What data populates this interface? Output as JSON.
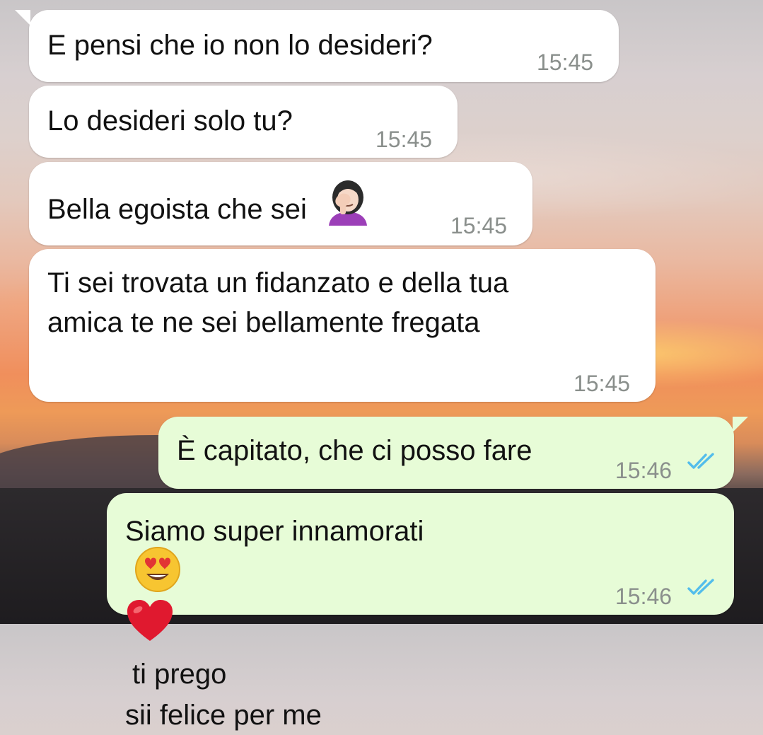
{
  "messages": [
    {
      "direction": "received",
      "text": "E pensi che io non lo desideri?",
      "time": "15:45"
    },
    {
      "direction": "received",
      "text": "Lo desideri solo tu?",
      "time": "15:45"
    },
    {
      "direction": "received",
      "text": "Bella egoista che sei",
      "emoji": "woman-facepalming",
      "time": "15:45"
    },
    {
      "direction": "received",
      "lines": [
        "Ti sei trovata un fidanzato e della tua",
        "amica te ne sei bellamente fregata"
      ],
      "time": "15:45"
    },
    {
      "direction": "sent",
      "text": "È capitato, che ci posso fare",
      "time": "15:46",
      "status": "read"
    },
    {
      "direction": "sent",
      "lines": [
        "Siamo super innamorati",
        "sii felice per me"
      ],
      "line1_tail": "ti prego",
      "emojis": [
        "heart-eyes-face",
        "red-heart"
      ],
      "time": "15:46",
      "status": "read"
    }
  ],
  "colors": {
    "received_bubble": "#ffffff",
    "sent_bubble": "#e7fcd7",
    "timestamp": "#8a8f8c",
    "read_ticks": "#53bdeb"
  }
}
